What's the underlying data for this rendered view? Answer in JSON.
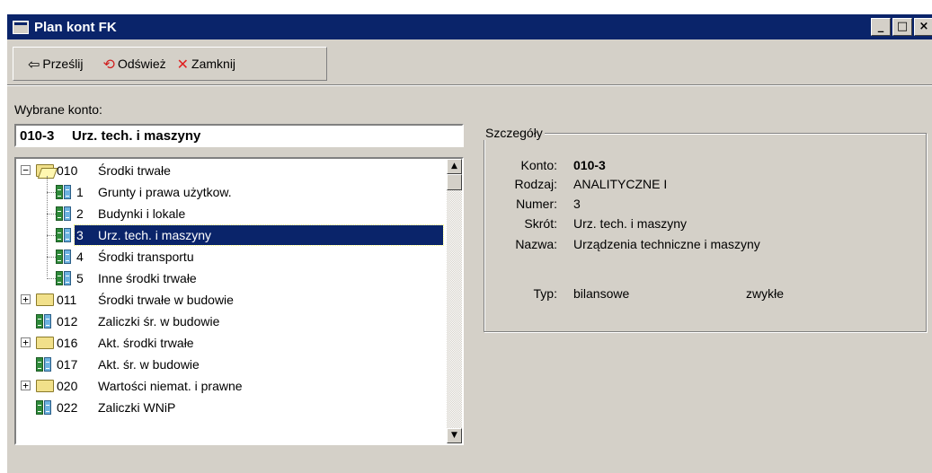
{
  "window": {
    "title": "Plan kont FK",
    "controls": [
      "_",
      "□",
      "×"
    ]
  },
  "toolbar": {
    "send": {
      "icon": "arrow-left-icon",
      "label": "Prześlij"
    },
    "refresh": {
      "icon": "refresh-icon",
      "label": "Odśwież"
    },
    "close": {
      "icon": "close-x-icon",
      "label": "Zamknij"
    }
  },
  "selected": {
    "label": "Wybrane konto:",
    "code": "010-3",
    "name": "Urz. tech. i maszyny"
  },
  "tree": [
    {
      "code": "010",
      "name": "Środki trwałe",
      "type": "folder-open",
      "expander": "−"
    },
    {
      "code": "1",
      "name": "Grunty i prawa użytkow.",
      "type": "doc"
    },
    {
      "code": "2",
      "name": "Budynki i lokale",
      "type": "doc"
    },
    {
      "code": "3",
      "name": "Urz. tech. i maszyny",
      "type": "doc",
      "selected": true
    },
    {
      "code": "4",
      "name": "Środki transportu",
      "type": "doc"
    },
    {
      "code": "5",
      "name": "Inne środki trwałe",
      "type": "doc"
    },
    {
      "code": "011",
      "name": "Środki trwałe w budowie",
      "type": "folder",
      "expander": "+"
    },
    {
      "code": "012",
      "name": "Zaliczki śr. w budowie",
      "type": "doc"
    },
    {
      "code": "016",
      "name": "Akt. środki trwałe",
      "type": "folder",
      "expander": "+"
    },
    {
      "code": "017",
      "name": "Akt. śr. w budowie",
      "type": "doc"
    },
    {
      "code": "020",
      "name": "Wartości niemat. i prawne",
      "type": "folder",
      "expander": "+"
    },
    {
      "code": "022",
      "name": "Zaliczki WNiP",
      "type": "doc"
    }
  ],
  "details": {
    "title": "Szczegóły",
    "konto_label": "Konto:",
    "konto": "010-3",
    "rodzaj_label": "Rodzaj:",
    "rodzaj": "ANALITYCZNE I",
    "numer_label": "Numer:",
    "numer": "3",
    "skrot_label": "Skrót:",
    "skrot": "Urz. tech. i maszyny",
    "nazwa_label": "Nazwa:",
    "nazwa": "Urządzenia techniczne i maszyny",
    "typ_label": "Typ:",
    "typ": "bilansowe",
    "typ2": "zwykłe"
  },
  "colors": {
    "titlebar": "#0a246a",
    "face": "#d4d0c8",
    "selection": "#0a246a",
    "close_x": "#e02020",
    "refresh": "#d02020"
  }
}
